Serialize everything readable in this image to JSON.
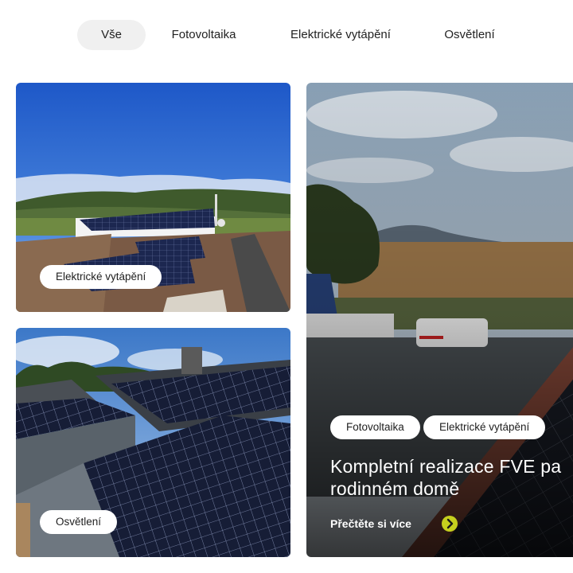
{
  "filters": {
    "items": [
      {
        "label": "Vše",
        "active": true
      },
      {
        "label": "Fotovoltaika",
        "active": false
      },
      {
        "label": "Elektrické vytápění",
        "active": false
      },
      {
        "label": "Osvětlení",
        "active": false
      }
    ]
  },
  "cards": [
    {
      "tags": [
        "Elektrické vytápění"
      ]
    },
    {
      "tags": [
        "Osvětlení"
      ]
    },
    {
      "tags": [
        "Fotovoltaika",
        "Elektrické vytápění"
      ],
      "title_line1": "Kompletní realizace FVE pa",
      "title_line2": "rodinném domě",
      "read_more": "Přečtěte si více"
    }
  ],
  "colors": {
    "accent": "#c5cf1e",
    "active_tab_bg": "#f0f0f0"
  },
  "icons": {
    "read_more": "chevron-right-icon"
  }
}
